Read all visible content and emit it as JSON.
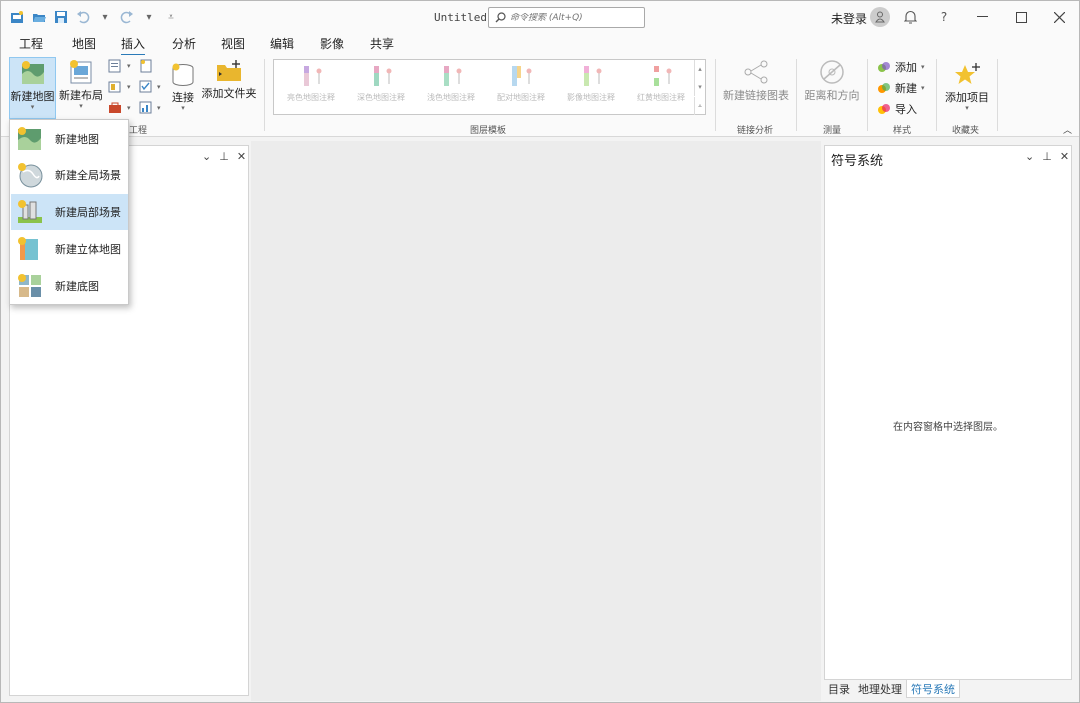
{
  "titlebar": {
    "doc_title": "Untitled",
    "search_placeholder": "命令搜索 (Alt+Q)",
    "login_label": "未登录",
    "help_label": "?"
  },
  "menu_tabs": [
    {
      "label": "工程",
      "active": false
    },
    {
      "label": "地图",
      "active": false
    },
    {
      "label": "插入",
      "active": true
    },
    {
      "label": "分析",
      "active": false
    },
    {
      "label": "视图",
      "active": false
    },
    {
      "label": "编辑",
      "active": false
    },
    {
      "label": "影像",
      "active": false
    },
    {
      "label": "共享",
      "active": false
    }
  ],
  "ribbon": {
    "new_map": "新建地图",
    "new_layout": "新建布局",
    "connect": "连接",
    "add_folder": "添加文件夹",
    "project_group": "工程",
    "gallery_items": [
      "亮色地图注释",
      "深色地图注释",
      "浅色地图注释",
      "配对地图注释",
      "影像地图注释",
      "红黄地图注释"
    ],
    "gallery_group": "图层模板",
    "new_link_chart": "新建链接图表",
    "link_group": "链接分析",
    "distance_direction": "距离和方向",
    "measure_group": "测量",
    "style_add": "添加",
    "style_new": "新建",
    "style_import": "导入",
    "style_group": "样式",
    "add_item": "添加项目",
    "favorites_group": "收藏夹"
  },
  "dropdown": {
    "items": [
      {
        "label": "新建地图",
        "highlighted": false
      },
      {
        "label": "新建全局场景",
        "highlighted": false
      },
      {
        "label": "新建局部场景",
        "highlighted": true
      },
      {
        "label": "新建立体地图",
        "highlighted": false
      },
      {
        "label": "新建底图",
        "highlighted": false
      }
    ]
  },
  "right_pane": {
    "title": "符号系统",
    "message": "在内容窗格中选择图层。"
  },
  "bottom_tabs": [
    {
      "label": "目录",
      "active": false
    },
    {
      "label": "地理处理",
      "active": false
    },
    {
      "label": "符号系统",
      "active": true
    }
  ],
  "colors": {
    "accent": "#2a7ab8",
    "highlight": "#cce4f7"
  }
}
